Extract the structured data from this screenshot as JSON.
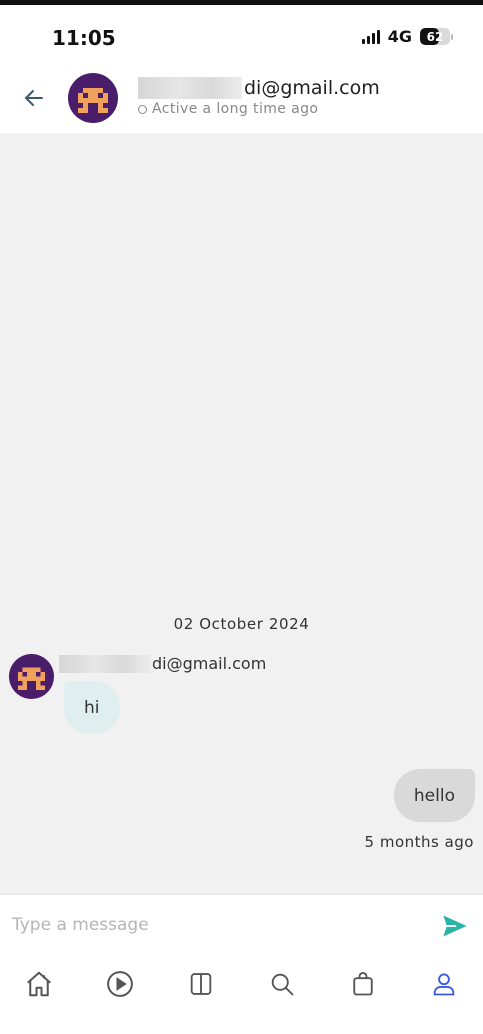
{
  "status_bar": {
    "time": "11:05",
    "network": "4G",
    "battery": "62",
    "battery_level": 0.62
  },
  "header": {
    "contact_email_visible": "di@gmail.com",
    "contact_status": "Active a long time ago"
  },
  "chat": {
    "date_separator": "02 October 2024",
    "messages": [
      {
        "direction": "incoming",
        "sender_visible": "di@gmail.com",
        "text": "hi"
      },
      {
        "direction": "outgoing",
        "text": "hello",
        "time": "5 months ago"
      }
    ]
  },
  "composer": {
    "placeholder": "Type a message",
    "value": ""
  },
  "colors": {
    "accent": "#2bb3a6",
    "avatar_bg": "#4a1d6b",
    "avatar_face": "#f0a15c",
    "incoming_bubble": "#dfeeee",
    "outgoing_bubble": "#d9d9d9",
    "nav_active": "#3b5bd9"
  },
  "bottom_nav": [
    {
      "icon": "home-icon",
      "active": false
    },
    {
      "icon": "play-circle-icon",
      "active": false
    },
    {
      "icon": "split-view-icon",
      "active": false
    },
    {
      "icon": "search-icon",
      "active": false
    },
    {
      "icon": "shopping-bag-icon",
      "active": false
    },
    {
      "icon": "profile-icon",
      "active": true
    }
  ]
}
